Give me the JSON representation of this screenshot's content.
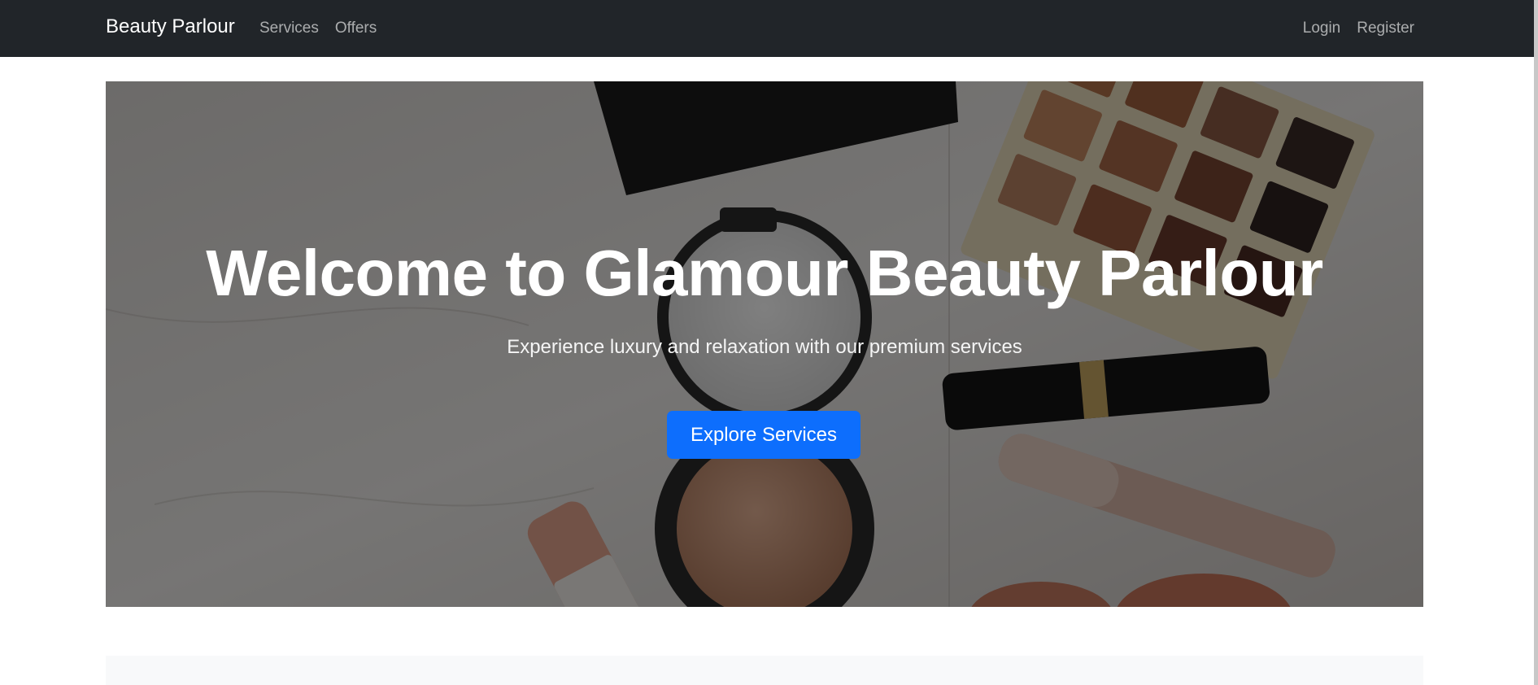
{
  "navbar": {
    "brand": "Beauty Parlour",
    "left_links": [
      {
        "label": "Services"
      },
      {
        "label": "Offers"
      }
    ],
    "right_links": [
      {
        "label": "Login"
      },
      {
        "label": "Register"
      }
    ]
  },
  "hero": {
    "title": "Welcome to Glamour Beauty Parlour",
    "subtitle": "Experience luxury and relaxation with our premium services",
    "cta_label": "Explore Services"
  },
  "colors": {
    "navbar_bg": "#212529",
    "primary": "#0d6efd",
    "section_bg": "#f8f9fa"
  }
}
